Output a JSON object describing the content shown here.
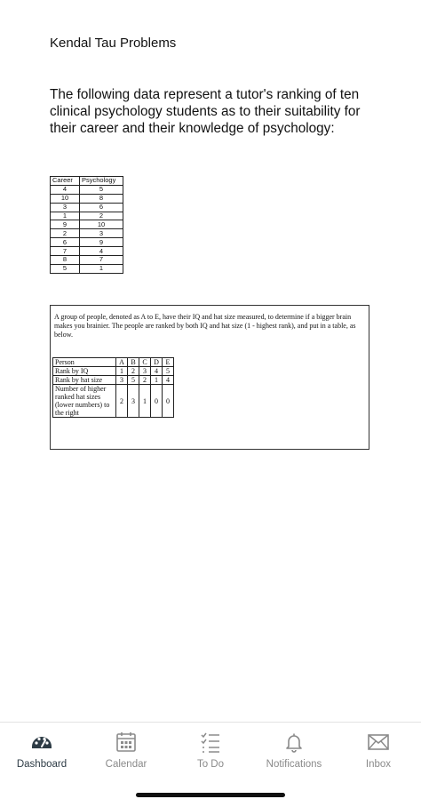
{
  "content": {
    "title": "Kendal Tau Problems",
    "intro": "The following data represent a tutor's ranking of ten clinical psychology students as to their suitability for their career and their knowledge of psychology:",
    "ranking_table": {
      "headers": [
        "Career",
        "Psychology"
      ],
      "rows": [
        [
          "4",
          "5"
        ],
        [
          "10",
          "8"
        ],
        [
          "3",
          "6"
        ],
        [
          "1",
          "2"
        ],
        [
          "9",
          "10"
        ],
        [
          "2",
          "3"
        ],
        [
          "6",
          "9"
        ],
        [
          "7",
          "4"
        ],
        [
          "8",
          "7"
        ],
        [
          "5",
          "1"
        ]
      ]
    },
    "problem": {
      "text": "A group of people, denoted as A to E, have their IQ and hat size measured, to determine if a bigger brain makes you brainier. The people are ranked by both IQ and hat size (1 - highest rank), and put in a table, as below.",
      "table": {
        "header": [
          "Person",
          "A",
          "B",
          "C",
          "D",
          "E"
        ],
        "rows": [
          [
            "Rank by IQ",
            "1",
            "2",
            "3",
            "4",
            "5"
          ],
          [
            "Rank by hat size",
            "3",
            "5",
            "2",
            "1",
            "4"
          ],
          [
            "Number of higher ranked hat sizes (lower numbers) to the right",
            "2",
            "3",
            "1",
            "0",
            "0"
          ]
        ]
      }
    }
  },
  "tabbar": {
    "tabs": [
      {
        "label": "Dashboard",
        "icon": "dashboard-icon",
        "active": true
      },
      {
        "label": "Calendar",
        "icon": "calendar-icon",
        "active": false
      },
      {
        "label": "To Do",
        "icon": "todo-icon",
        "active": false
      },
      {
        "label": "Notifications",
        "icon": "bell-icon",
        "active": false
      },
      {
        "label": "Inbox",
        "icon": "mail-icon",
        "active": false
      }
    ],
    "active_color": "#2d3b45",
    "inactive_color": "#8a8a8a"
  }
}
